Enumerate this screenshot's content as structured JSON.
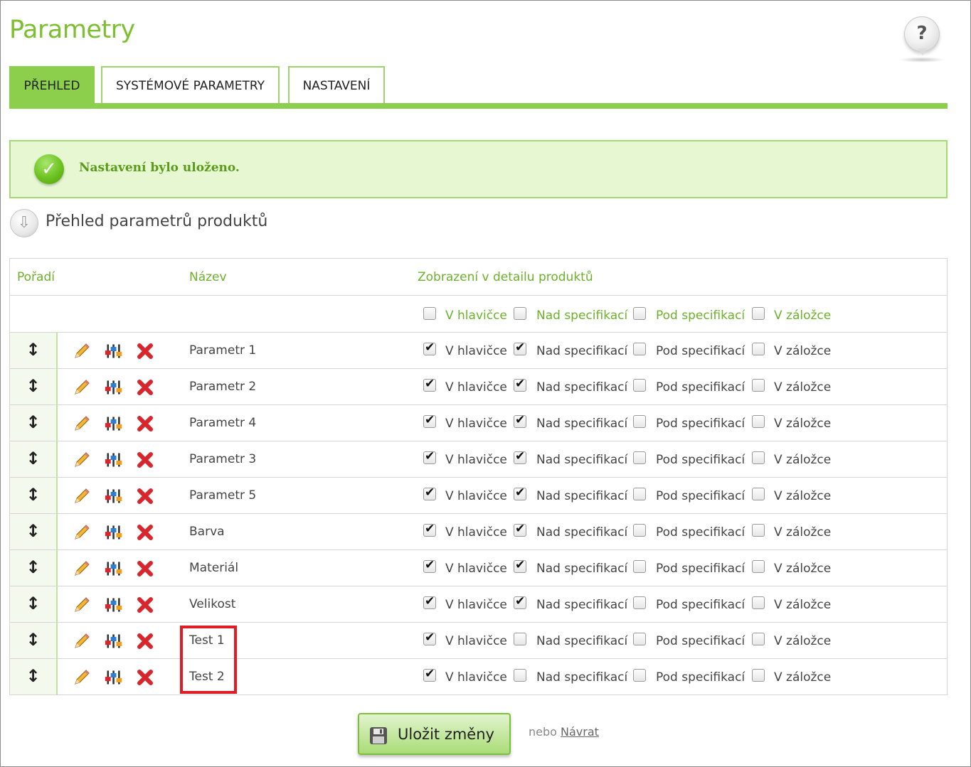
{
  "page": {
    "title": "Parametry",
    "help_label": "?"
  },
  "tabs": [
    {
      "label": "PŘEHLED",
      "active": true
    },
    {
      "label": "SYSTÉMOVÉ PARAMETRY",
      "active": false
    },
    {
      "label": "NASTAVENÍ",
      "active": false
    }
  ],
  "alert": {
    "text": "Nastavení bylo uloženo.",
    "icon": "check-icon"
  },
  "section": {
    "title": "Přehled parametrů produktů",
    "icon": "arrow-down-icon"
  },
  "table": {
    "headers": {
      "order": "Pořadí",
      "name": "Název",
      "display": "Zobrazení v detailu produktů"
    },
    "filter": {
      "labels": [
        "V hlavičce",
        "Nad specifikací",
        "Pod specifikací",
        "V záložce"
      ],
      "checked": [
        false,
        false,
        false,
        false
      ]
    },
    "rows": [
      {
        "name": "Parametr 1",
        "labels": [
          "V hlavičce",
          "Nad specifikací",
          "Pod specifikací",
          "V záložce"
        ],
        "checked": [
          true,
          true,
          false,
          false
        ]
      },
      {
        "name": "Parametr 2",
        "labels": [
          "V hlavičce",
          "Nad specifikací",
          "Pod specifikací",
          "V záložce"
        ],
        "checked": [
          true,
          true,
          false,
          false
        ]
      },
      {
        "name": "Parametr 4",
        "labels": [
          "V hlavičce",
          "Nad specifikací",
          "Pod specifikací",
          "V záložce"
        ],
        "checked": [
          true,
          true,
          false,
          false
        ]
      },
      {
        "name": "Parametr 3",
        "labels": [
          "V hlavičce",
          "Nad specifikací",
          "Pod specifikací",
          "V záložce"
        ],
        "checked": [
          true,
          true,
          false,
          false
        ]
      },
      {
        "name": "Parametr 5",
        "labels": [
          "V hlavičce",
          "Nad specifikací",
          "Pod specifikací",
          "V záložce"
        ],
        "checked": [
          true,
          true,
          false,
          false
        ]
      },
      {
        "name": "Barva",
        "labels": [
          "V hlavičce",
          "Nad specifikací",
          "Pod specifikací",
          "V záložce"
        ],
        "checked": [
          true,
          true,
          false,
          false
        ]
      },
      {
        "name": "Materiál",
        "labels": [
          "V hlavičce",
          "Nad specifikací",
          "Pod specifikací",
          "V záložce"
        ],
        "checked": [
          true,
          true,
          false,
          false
        ]
      },
      {
        "name": "Velikost",
        "labels": [
          "V hlavičce",
          "Nad specifikací",
          "Pod specifikací",
          "V záložce"
        ],
        "checked": [
          true,
          true,
          false,
          false
        ]
      },
      {
        "name": "Test 1",
        "labels": [
          "V hlavičce",
          "Nad specifikací",
          "Pod specifikací",
          "V záložce"
        ],
        "checked": [
          true,
          false,
          false,
          false
        ]
      },
      {
        "name": "Test 2",
        "labels": [
          "V hlavičce",
          "Nad specifikací",
          "Pod specifikací",
          "V záložce"
        ],
        "checked": [
          true,
          false,
          false,
          false
        ]
      }
    ]
  },
  "footer": {
    "save_label": "Uložit změny",
    "or_text": "nebo",
    "back_label": "Návrat"
  },
  "colors": {
    "accent": "#8ccf4c",
    "title_green": "#7cbf2f",
    "alert_bg": "#e6f7d2",
    "highlight": "#e01b24",
    "delete_red": "#d9262c"
  }
}
